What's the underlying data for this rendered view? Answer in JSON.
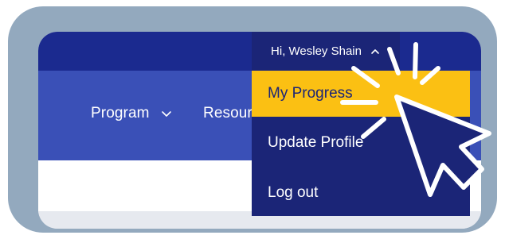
{
  "colors": {
    "frame": "#93a9be",
    "top_bar": "#1b2a8f",
    "nav_bar": "#3a50b7",
    "dropdown": "#1b2577",
    "highlight": "#fbc013",
    "text_light": "#ffffff"
  },
  "header": {
    "greeting": "Hi, Wesley Shain"
  },
  "nav": {
    "items": [
      {
        "label": "Program"
      },
      {
        "label": "Resour"
      }
    ]
  },
  "user_menu": {
    "items": [
      {
        "label": "My Progress",
        "state": "highlighted"
      },
      {
        "label": "Update Profile"
      },
      {
        "label": "Log out"
      }
    ]
  },
  "icons": {
    "nav_dropdown": "chevron-down-icon",
    "user_menu_toggle": "chevron-up-icon",
    "pointer": "hand-cursor-icon",
    "click_effect": "click-burst-icon"
  }
}
